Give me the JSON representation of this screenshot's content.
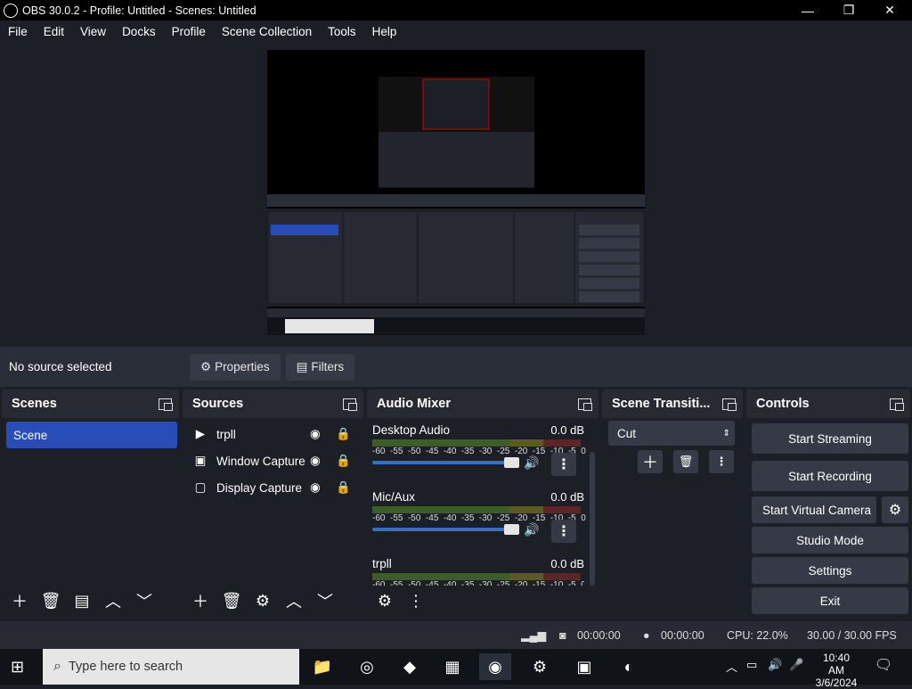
{
  "window": {
    "title": "OBS 30.0.2 - Profile: Untitled - Scenes: Untitled",
    "minimize": "—",
    "maximize": "❐",
    "close": "✕"
  },
  "menu": [
    "File",
    "Edit",
    "View",
    "Docks",
    "Profile",
    "Scene Collection",
    "Tools",
    "Help"
  ],
  "context": {
    "no_source": "No source selected",
    "properties": "Properties",
    "filters": "Filters"
  },
  "scenes": {
    "title": "Scenes",
    "items": [
      "Scene"
    ]
  },
  "sources": {
    "title": "Sources",
    "items": [
      {
        "name": "trpll",
        "icon": "play-icon"
      },
      {
        "name": "Window Capture",
        "icon": "window-icon"
      },
      {
        "name": "Display Capture",
        "icon": "monitor-icon"
      }
    ]
  },
  "mixer": {
    "title": "Audio Mixer",
    "ticks": [
      "-60",
      "-55",
      "-50",
      "-45",
      "-40",
      "-35",
      "-30",
      "-25",
      "-20",
      "-15",
      "-10",
      "-5",
      "0"
    ],
    "channels": [
      {
        "name": "Desktop Audio",
        "db": "0.0 dB"
      },
      {
        "name": "Mic/Aux",
        "db": "0.0 dB"
      },
      {
        "name": "trpll",
        "db": "0.0 dB"
      }
    ]
  },
  "transitions": {
    "title": "Scene Transiti...",
    "selected": "Cut"
  },
  "controls": {
    "title": "Controls",
    "start_streaming": "Start Streaming",
    "start_recording": "Start Recording",
    "start_virtual_camera": "Start Virtual Camera",
    "studio_mode": "Studio Mode",
    "settings": "Settings",
    "exit": "Exit"
  },
  "status": {
    "stream_time": "00:00:00",
    "record_time": "00:00:00",
    "cpu": "CPU: 22.0%",
    "fps": "30.00 / 30.00 FPS"
  },
  "taskbar": {
    "search_placeholder": "Type here to search",
    "time": "10:40 AM",
    "date": "3/6/2024"
  },
  "colors": {
    "accent": "#284cb8",
    "dock_bg": "#272a33",
    "base_bg": "#1d1f26"
  }
}
